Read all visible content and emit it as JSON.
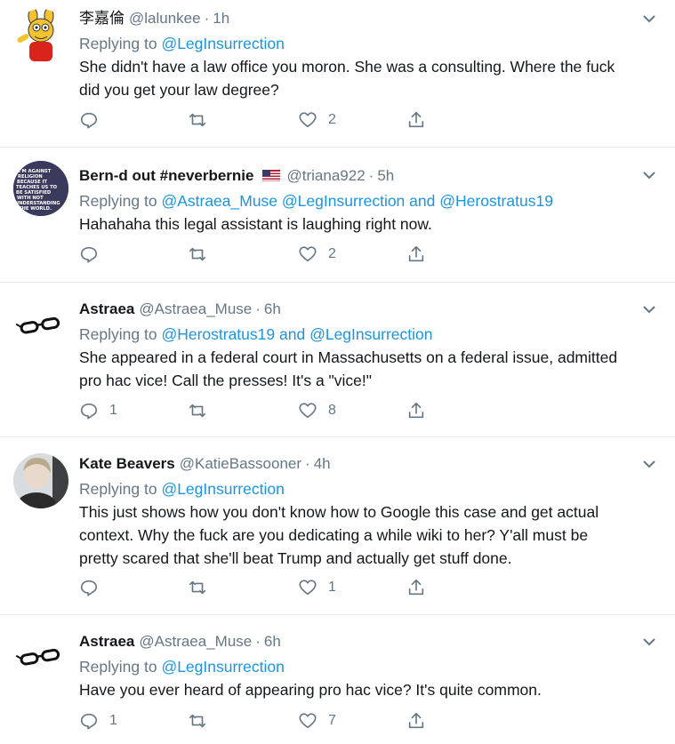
{
  "tweets": [
    {
      "name": "李嘉倫",
      "handle": "@lalunkee",
      "time": "1h",
      "reply_label": "Replying to",
      "reply_to": "@LegInsurrection",
      "reply_conj": "",
      "reply_to2": "",
      "text": [
        "She didn't have a law office you moron. She was a consulting. Where the fuck",
        "did you get your law degree?"
      ],
      "reply_count": "",
      "retweet_count": "",
      "like_count": "2"
    },
    {
      "name": "Bern-d out #neverbernie",
      "handle": "@triana922",
      "time": "5h",
      "reply_label": "Replying to",
      "reply_to": "@Astraea_Muse @LegInsurrection",
      "reply_conj": "and",
      "reply_to2": "@Herostratus19",
      "text": [
        "Hahahaha this legal assistant is laughing right now."
      ],
      "avatar_text": [
        "I'M AGAINST",
        "RELIGION",
        "BECAUSE IT",
        "TEACHES US TO",
        "BE SATISFIED",
        "WITH NOT",
        "UNDERSTANDING",
        "THE WORLD."
      ],
      "reply_count": "",
      "retweet_count": "",
      "like_count": "2"
    },
    {
      "name": "Astraea",
      "handle": "@Astraea_Muse",
      "time": "6h",
      "reply_label": "Replying to",
      "reply_to": "@Herostratus19",
      "reply_conj": "and",
      "reply_to2": "@LegInsurrection",
      "text": [
        "She appeared in a federal court in Massachusetts on a federal issue, admitted",
        "pro hac vice!  Call the presses!  It's a \"vice!\""
      ],
      "reply_count": "1",
      "retweet_count": "",
      "like_count": "8"
    },
    {
      "name": "Kate Beavers",
      "handle": "@KatieBassooner",
      "time": "4h",
      "reply_label": "Replying to",
      "reply_to": "@LegInsurrection",
      "reply_conj": "",
      "reply_to2": "",
      "text": [
        "This just shows how you don't know how to Google this case and get actual",
        "context. Why the fuck are you dedicating a while wiki to her? Y'all must be",
        "pretty scared that she'll beat Trump and actually get stuff done."
      ],
      "reply_count": "",
      "retweet_count": "",
      "like_count": "1"
    },
    {
      "name": "Astraea",
      "handle": "@Astraea_Muse",
      "time": "6h",
      "reply_label": "Replying to",
      "reply_to": "@LegInsurrection",
      "reply_conj": "",
      "reply_to2": "",
      "text": [
        "Have you ever heard of appearing pro hac vice?  It's quite common."
      ],
      "reply_count": "1",
      "retweet_count": "",
      "like_count": "7"
    }
  ],
  "colors": {
    "link": "#1b95e0",
    "secondary": "#657786",
    "border": "#e6ecf0"
  },
  "icons": [
    "reply-icon",
    "retweet-icon",
    "like-icon",
    "share-icon",
    "chevron-down-icon",
    "us-flag-icon"
  ]
}
